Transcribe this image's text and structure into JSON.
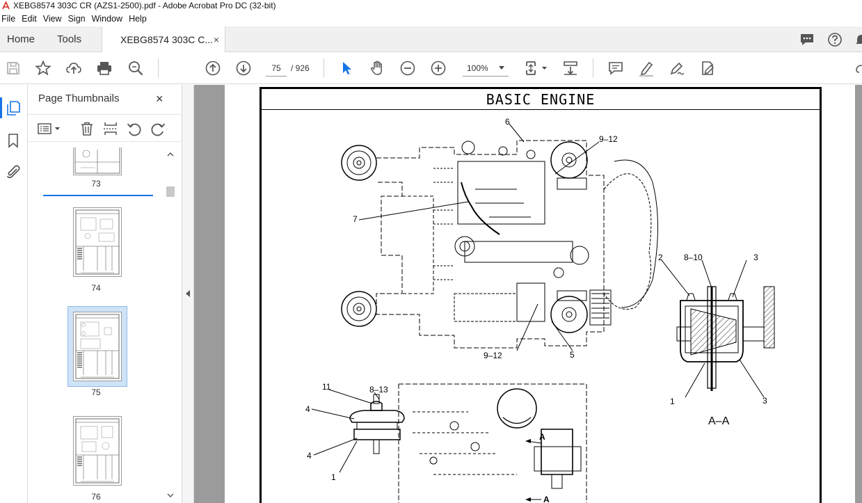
{
  "window": {
    "title": "XEBG8574 303C CR (AZS1-2500).pdf - Adobe Acrobat Pro DC (32-bit)"
  },
  "menu": [
    "File",
    "Edit",
    "View",
    "Sign",
    "Window",
    "Help"
  ],
  "tabs": {
    "home": "Home",
    "tools": "Tools",
    "document": "XEBG8574 303C C...",
    "close": "×"
  },
  "toolbar": {
    "current_page": "75",
    "total_pages": "/  926",
    "zoom": "100%"
  },
  "panel": {
    "title": "Page Thumbnails",
    "close": "×",
    "thumbnails": [
      {
        "label": "73"
      },
      {
        "label": "74"
      },
      {
        "label": "75",
        "selected": true
      },
      {
        "label": "76"
      }
    ]
  },
  "document": {
    "heading": "BASIC ENGINE",
    "callouts": {
      "c6": "6",
      "c9_12_top": "9–12",
      "c7": "7",
      "c2": "2",
      "c8_10": "8–10",
      "c3_top": "3",
      "c9_12_bottom": "9–12",
      "c5": "5",
      "c1_right": "1",
      "c3_bottom": "3",
      "section": "A–A",
      "c11": "11",
      "c8_13": "8–13",
      "c4_top": "4",
      "c4_bottom": "4",
      "c1_left": "1",
      "a_top": "A",
      "a_bottom": "A"
    }
  },
  "colors": {
    "accent": "#1473e6",
    "doc_background": "#9b9b9b",
    "icon": "#555555",
    "pdf_icon": "#d82a20"
  }
}
